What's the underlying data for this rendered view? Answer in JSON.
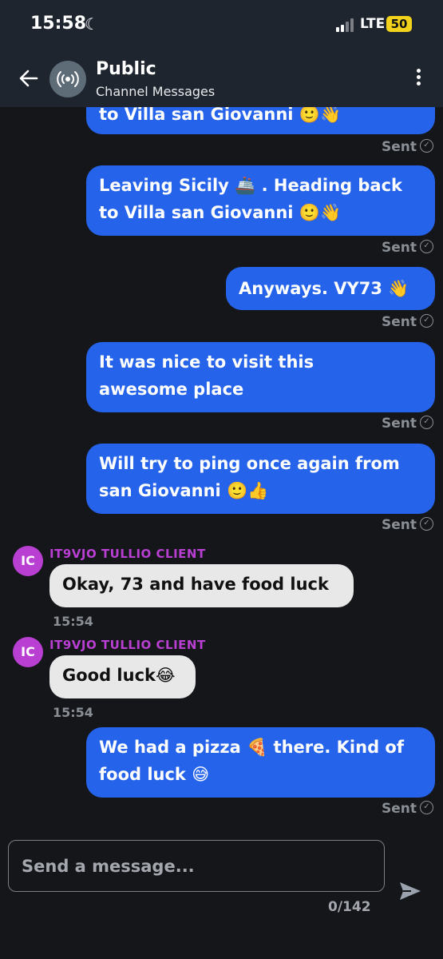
{
  "status_bar": {
    "time": "15:58",
    "moon": "☾",
    "network": "LTE",
    "battery": "50"
  },
  "header": {
    "title": "Public",
    "subtitle": "Channel Messages"
  },
  "messages": [
    {
      "direction": "out",
      "lines": [
        "to Villa san Giovanni 🙂👋"
      ],
      "status": "Sent"
    },
    {
      "direction": "out",
      "lines": [
        "Leaving Sicily 🚢 . Heading back",
        "to Villa san Giovanni 🙂👋"
      ],
      "status": "Sent"
    },
    {
      "direction": "out",
      "lines": [
        "Anyways. VY73 👋"
      ],
      "status": "Sent"
    },
    {
      "direction": "out",
      "lines": [
        "It was nice to visit this",
        "awesome place"
      ],
      "status": "Sent"
    },
    {
      "direction": "out",
      "lines": [
        "Will try to ping once again from",
        "san Giovanni 🙂👍"
      ],
      "status": "Sent"
    },
    {
      "direction": "in",
      "avatar": "IC",
      "sender": "IT9VJO TULLIO CLIENT",
      "text": "Okay, 73 and have food luck",
      "time": "15:54"
    },
    {
      "direction": "in",
      "avatar": "IC",
      "sender": "IT9VJO TULLIO CLIENT",
      "text": "Good luck😂",
      "time": "15:54"
    },
    {
      "direction": "out",
      "lines": [
        "We had a pizza 🍕  there. Kind of",
        "food luck 😅"
      ],
      "status": "Sent"
    }
  ],
  "composer": {
    "placeholder": "Send a message...",
    "counter": "0/142"
  }
}
